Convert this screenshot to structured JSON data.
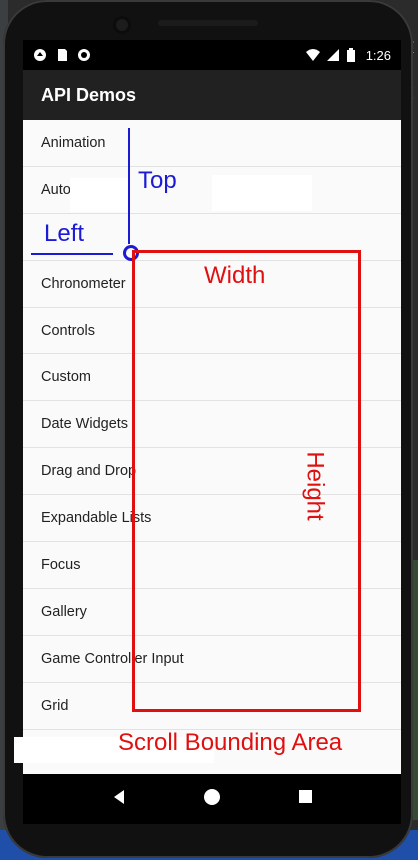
{
  "status_bar": {
    "time": "1:26"
  },
  "app_bar": {
    "title": "API Demos"
  },
  "list_items": [
    "Animation",
    "Auto",
    "",
    "Chronometer",
    "Controls",
    "Custom",
    "Date Widgets",
    "Drag and Drop",
    "Expandable Lists",
    "Focus",
    "Gallery",
    "Game Controller Input",
    "Grid",
    "",
    ""
  ],
  "annotations": {
    "top": "Top",
    "left": "Left",
    "width": "Width",
    "height": "Height",
    "scroll_area": "Scroll Bounding Area"
  },
  "colors": {
    "annotation_blue": "#1b1bd6",
    "annotation_red": "#e01010",
    "app_bar": "#212121"
  },
  "icons": [
    "notification-icon",
    "sd-card-icon",
    "sync-icon",
    "wifi-icon",
    "signal-icon",
    "battery-icon",
    "back-icon",
    "home-icon",
    "recents-icon"
  ]
}
